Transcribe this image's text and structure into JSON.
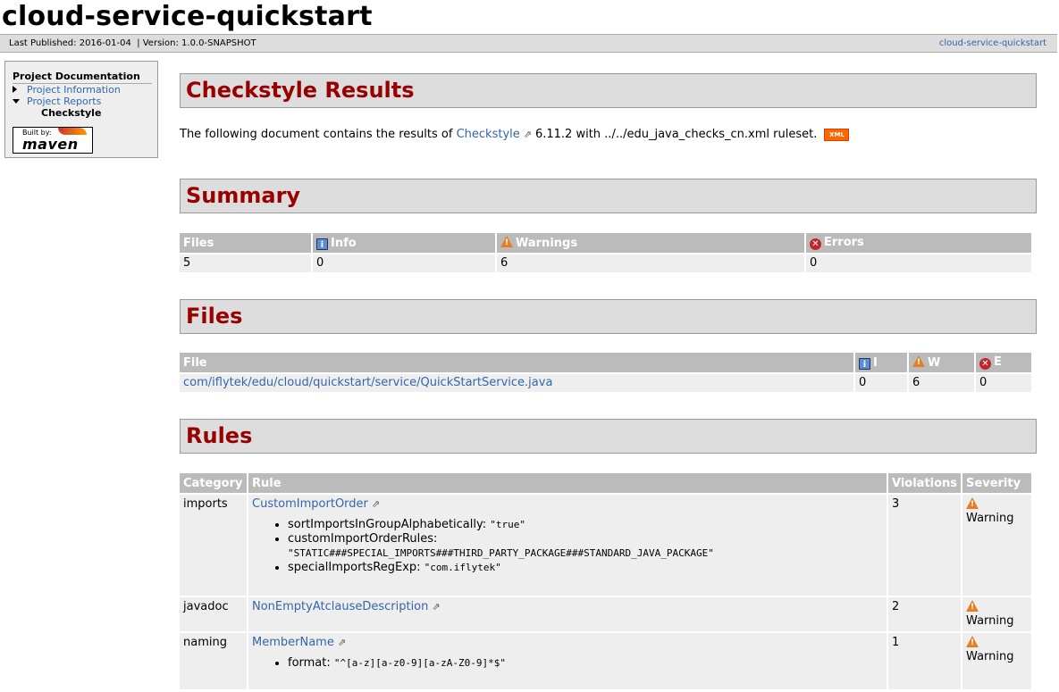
{
  "header": {
    "title": "cloud-service-quickstart",
    "last_published": "Last Published: 2016-01-04",
    "version": "| Version: 1.0.0-SNAPSHOT",
    "project_link": "cloud-service-quickstart"
  },
  "nav": {
    "heading": "Project Documentation",
    "items": [
      "Project Information",
      "Project Reports"
    ],
    "sub_item": "Checkstyle",
    "built_by": "Built by:",
    "maven": "maven"
  },
  "page": {
    "title": "Checkstyle Results",
    "intro_prefix": "The following document contains the results of",
    "checkstyle_link": "Checkstyle",
    "intro_suffix": "6.11.2 with ../../edu_java_checks_cn.xml ruleset.",
    "xml_badge": "XML"
  },
  "summary": {
    "heading": "Summary",
    "headers": [
      "Files",
      "Info",
      "Warnings",
      "Errors"
    ],
    "values": [
      "5",
      "0",
      "6",
      "0"
    ]
  },
  "files": {
    "heading": "Files",
    "headers": [
      "File",
      "I",
      "W",
      "E"
    ],
    "rows": [
      {
        "file": "com/iflytek/edu/cloud/quickstart/service/QuickStartService.java",
        "i": "0",
        "w": "6",
        "e": "0"
      }
    ]
  },
  "rules": {
    "heading": "Rules",
    "headers": [
      "Category",
      "Rule",
      "Violations",
      "Severity"
    ],
    "rows": [
      {
        "category": "imports",
        "rule": "CustomImportOrder",
        "violations": "3",
        "severity": "Warning",
        "props": [
          {
            "name": "sortImportsInGroupAlphabetically:",
            "value": "\"true\""
          },
          {
            "name": "customImportOrderRules:",
            "value": "\"STATIC###SPECIAL_IMPORTS###THIRD_PARTY_PACKAGE###STANDARD_JAVA_PACKAGE\""
          },
          {
            "name": "specialImportsRegExp:",
            "value": "\"com.iflytek\""
          }
        ]
      },
      {
        "category": "javadoc",
        "rule": "NonEmptyAtclauseDescription",
        "violations": "2",
        "severity": "Warning",
        "props": []
      },
      {
        "category": "naming",
        "rule": "MemberName",
        "violations": "1",
        "severity": "Warning",
        "props": [
          {
            "name": "format:",
            "value": "\"^[a-z][a-z0-9][a-zA-Z0-9]*$\""
          }
        ]
      }
    ]
  }
}
